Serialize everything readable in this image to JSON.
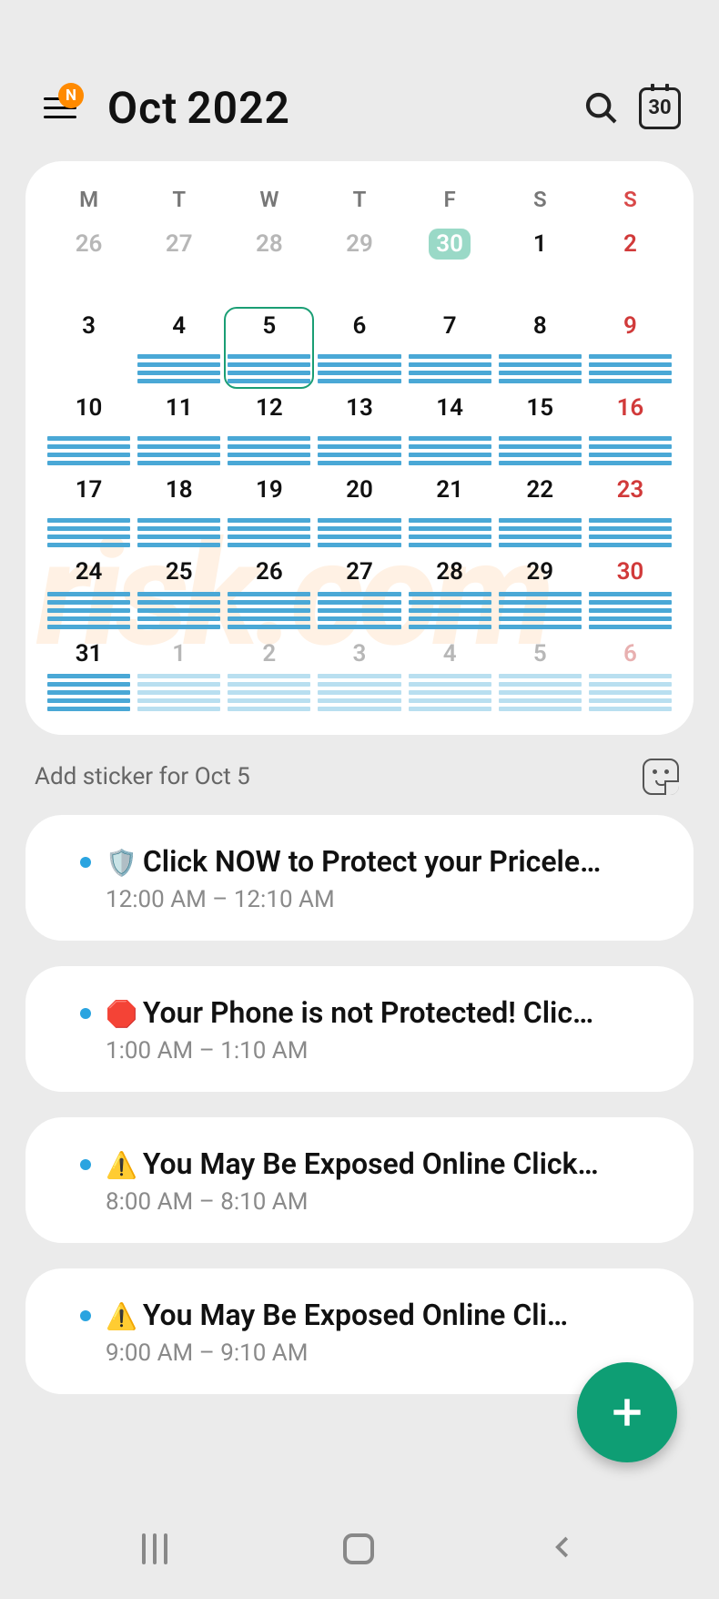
{
  "header": {
    "menu_badge": "N",
    "month": "Oct",
    "year": "2022",
    "today_icon_number": "30"
  },
  "calendar": {
    "days_of_week": [
      "M",
      "T",
      "W",
      "T",
      "F",
      "S",
      "S"
    ],
    "weeks": [
      [
        {
          "n": "26",
          "prev": true,
          "bars": 0
        },
        {
          "n": "27",
          "prev": true,
          "bars": 0
        },
        {
          "n": "28",
          "prev": true,
          "bars": 0
        },
        {
          "n": "29",
          "prev": true,
          "bars": 0
        },
        {
          "n": "30",
          "prev": true,
          "today": true,
          "bars": 0
        },
        {
          "n": "1",
          "bars": 0
        },
        {
          "n": "2",
          "sun": true,
          "bars": 0
        }
      ],
      [
        {
          "n": "3",
          "bars": 0
        },
        {
          "n": "4",
          "bars": 4
        },
        {
          "n": "5",
          "selected": true,
          "bars": 4
        },
        {
          "n": "6",
          "bars": 4
        },
        {
          "n": "7",
          "bars": 4
        },
        {
          "n": "8",
          "bars": 4
        },
        {
          "n": "9",
          "sun": true,
          "bars": 4
        }
      ],
      [
        {
          "n": "10",
          "bars": 4
        },
        {
          "n": "11",
          "bars": 4
        },
        {
          "n": "12",
          "bars": 4
        },
        {
          "n": "13",
          "bars": 4
        },
        {
          "n": "14",
          "bars": 4
        },
        {
          "n": "15",
          "bars": 4
        },
        {
          "n": "16",
          "sun": true,
          "bars": 4
        }
      ],
      [
        {
          "n": "17",
          "bars": 4
        },
        {
          "n": "18",
          "bars": 4
        },
        {
          "n": "19",
          "bars": 4
        },
        {
          "n": "20",
          "bars": 4
        },
        {
          "n": "21",
          "bars": 4
        },
        {
          "n": "22",
          "bars": 4
        },
        {
          "n": "23",
          "sun": true,
          "bars": 4
        }
      ],
      [
        {
          "n": "24",
          "bars": 5
        },
        {
          "n": "25",
          "bars": 5
        },
        {
          "n": "26",
          "bars": 5
        },
        {
          "n": "27",
          "bars": 5
        },
        {
          "n": "28",
          "bars": 5
        },
        {
          "n": "29",
          "bars": 5
        },
        {
          "n": "30",
          "sun": true,
          "bars": 5
        }
      ],
      [
        {
          "n": "31",
          "bars": 5
        },
        {
          "n": "1",
          "next": true,
          "bars": 5
        },
        {
          "n": "2",
          "next": true,
          "bars": 5
        },
        {
          "n": "3",
          "next": true,
          "bars": 5
        },
        {
          "n": "4",
          "next": true,
          "bars": 5
        },
        {
          "n": "5",
          "next": true,
          "bars": 5
        },
        {
          "n": "6",
          "next": true,
          "sun": true,
          "bars": 5
        }
      ]
    ]
  },
  "sticker_prompt": "Add sticker for Oct 5",
  "events": [
    {
      "emoji": "🛡️",
      "title": "Click NOW to Protect your Pricele…",
      "time": "12:00 AM – 12:10 AM"
    },
    {
      "emoji": "🛑",
      "title": "Your Phone is not Protected! Clic…",
      "time": "1:00 AM – 1:10 AM"
    },
    {
      "emoji": "⚠️",
      "title": "You May Be Exposed Online  Click…",
      "time": "8:00 AM – 8:10 AM"
    },
    {
      "emoji": "⚠️",
      "title": "You May Be Exposed Online  Cli…",
      "time": "9:00 AM – 9:10 AM"
    }
  ],
  "watermark": "risk.com"
}
